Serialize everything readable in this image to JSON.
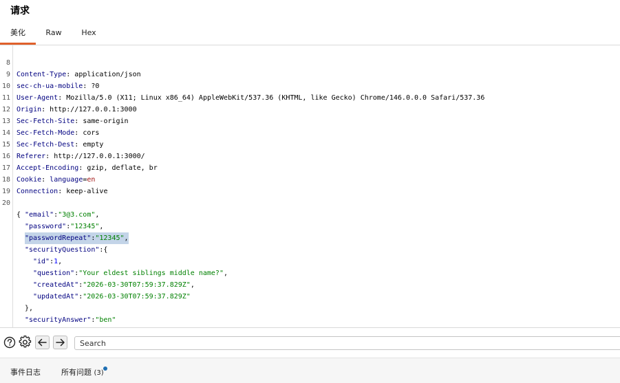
{
  "panel": {
    "title": "请求"
  },
  "tabs": [
    {
      "label": "美化",
      "active": true
    },
    {
      "label": "Raw",
      "active": false
    },
    {
      "label": "Hex",
      "active": false
    }
  ],
  "headers": [
    {
      "num": "8",
      "name": "Content-Type",
      "value": "application/json"
    },
    {
      "num": "9",
      "name": "sec-ch-ua-mobile",
      "value": "?0"
    },
    {
      "num": "10",
      "name": "User-Agent",
      "value": "Mozilla/5.0 (X11; Linux x86_64) AppleWebKit/537.36 (KHTML, like Gecko) Chrome/146.0.0.0 Safari/537.36"
    },
    {
      "num": "11",
      "name": "Origin",
      "value": "http://127.0.0.1:3000"
    },
    {
      "num": "12",
      "name": "Sec-Fetch-Site",
      "value": "same-origin"
    },
    {
      "num": "13",
      "name": "Sec-Fetch-Mode",
      "value": "cors"
    },
    {
      "num": "14",
      "name": "Sec-Fetch-Dest",
      "value": "empty"
    },
    {
      "num": "15",
      "name": "Referer",
      "value": "http://127.0.0.1:3000/"
    },
    {
      "num": "16",
      "name": "Accept-Encoding",
      "value": "gzip, deflate, br"
    }
  ],
  "cookie": {
    "num": "17",
    "name": "Cookie",
    "cookie_name": "language",
    "cookie_value": "en"
  },
  "connection": {
    "num": "18",
    "name": "Connection",
    "value": "keep-alive"
  },
  "blank_line_num": "19",
  "body": {
    "start_num": "20",
    "email_key": "\"email\"",
    "email_value": "\"3@3.com\"",
    "password_key": "\"password\"",
    "password_value": "\"12345\"",
    "password_repeat_key": "\"passwordRepeat\"",
    "password_repeat_value": "\"12345\"",
    "security_question_key": "\"securityQuestion\"",
    "id_key": "\"id\"",
    "id_value": "1",
    "question_key": "\"question\"",
    "question_value": "\"Your eldest siblings middle name?\"",
    "created_key": "\"createdAt\"",
    "created_value": "\"2026-03-30T07:59:37.829Z\"",
    "updated_key": "\"updatedAt\"",
    "updated_value": "\"2026-03-30T07:59:37.829Z\"",
    "security_answer_key": "\"securityAnswer\"",
    "security_answer_value": "\"ben\""
  },
  "toolbar": {
    "help_icon": "help-circle-icon",
    "settings_icon": "gear-icon",
    "back_icon": "arrow-left-icon",
    "forward_icon": "arrow-right-icon",
    "search_placeholder": "Search"
  },
  "status_bar": {
    "event_log": "事件日志",
    "all_issues": "所有问题",
    "issues_count": "(3)",
    "indicator_color": "#1f6fb3"
  },
  "colors": {
    "active_tab_accent": "#e0602b",
    "selection": "#c3d4e8"
  }
}
